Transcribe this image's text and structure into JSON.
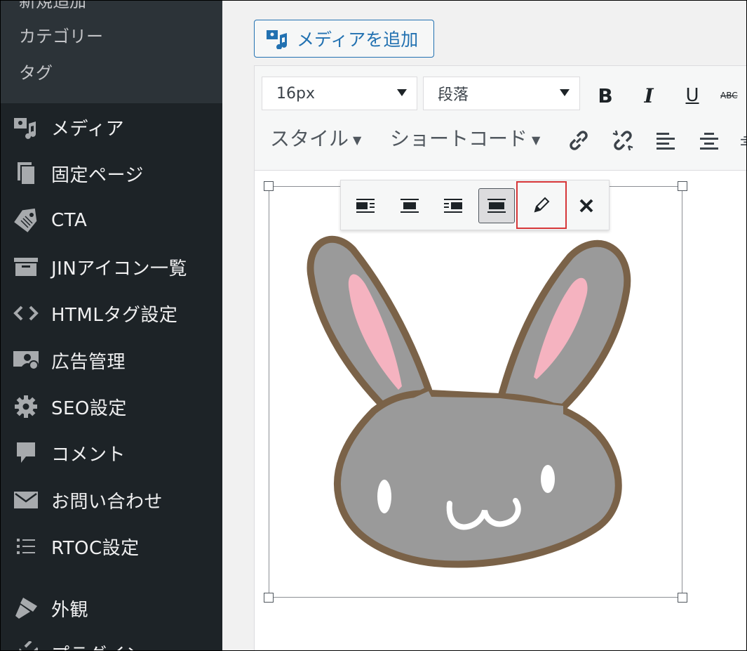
{
  "sidebar": {
    "submenu": [
      "新規追加",
      "カテゴリー",
      "タグ"
    ],
    "items": [
      {
        "label": "メディア",
        "icon": "media-icon"
      },
      {
        "label": "固定ページ",
        "icon": "pages-icon"
      },
      {
        "label": "CTA",
        "icon": "tag-icon"
      },
      {
        "label": "JINアイコン一覧",
        "icon": "archive-icon"
      },
      {
        "label": "HTMLタグ設定",
        "icon": "code-icon"
      },
      {
        "label": "広告管理",
        "icon": "ads-icon"
      },
      {
        "label": "SEO設定",
        "icon": "gear-icon"
      },
      {
        "label": "コメント",
        "icon": "comment-icon"
      },
      {
        "label": "お問い合わせ",
        "icon": "mail-icon"
      },
      {
        "label": "RTOC設定",
        "icon": "list-icon"
      },
      {
        "label": "外観",
        "icon": "brush-icon"
      },
      {
        "label": "プラグイン",
        "icon": "plugin-icon"
      }
    ]
  },
  "editor": {
    "add_media_label": "メディアを追加",
    "font_size": "16px",
    "paragraph": "段落",
    "style_label": "スタイル",
    "shortcode_label": "ショートコード",
    "bold": "B",
    "italic": "I",
    "underline": "U",
    "strike": "ABC"
  },
  "colors": {
    "sidebar_bg": "#1d2327",
    "accent": "#2271b1",
    "highlight_box": "#d63638"
  }
}
